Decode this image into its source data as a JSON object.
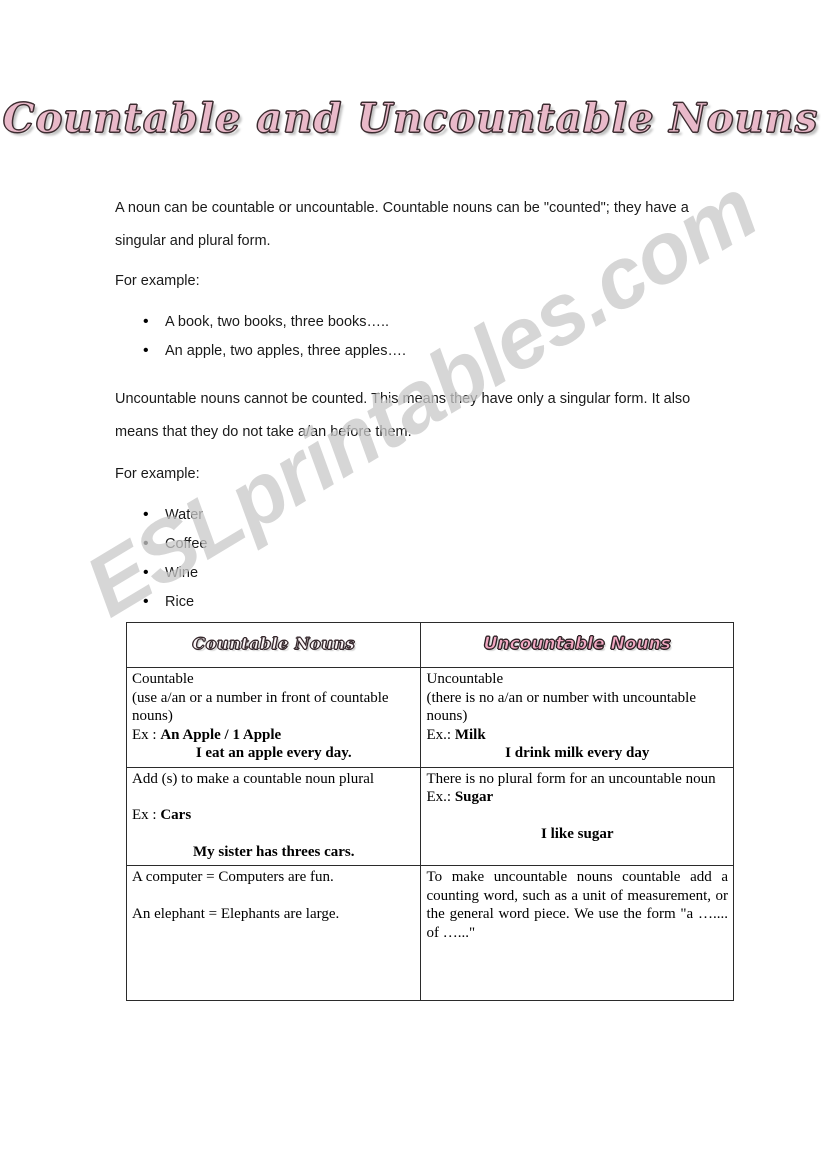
{
  "document": {
    "title": "Countable and Uncountable Nouns",
    "watermark": "ESLprintables.com"
  },
  "intro": {
    "paragraph1": "A noun can be countable or uncountable. Countable nouns can be \"counted\"; they have a singular and plural form.",
    "for_example_1": "For example:",
    "examples1": [
      "A book, two books, three books…..",
      "An apple, two apples, three apples…."
    ],
    "paragraph2": "Uncountable nouns cannot be counted. This means they have only a singular form. It also means that they do not take a/an before them.",
    "for_example_2": "For example:",
    "examples2": [
      "Water",
      "Coffee",
      "Wine",
      "Rice"
    ]
  },
  "table": {
    "headers": {
      "countable": "Countable Nouns",
      "uncountable": "Uncountable Nouns"
    },
    "rows": [
      {
        "countable": {
          "line1": "Countable",
          "line2": "(use a/an or a number in front of countable nouns)",
          "ex_label": "Ex :",
          "ex_value": "An Apple / 1 Apple",
          "sentence": "I eat an apple every day."
        },
        "uncountable": {
          "line1": "Uncountable",
          "line2": "(there is no a/an or number with uncountable nouns)",
          "ex_label": "Ex.:",
          "ex_value": "Milk",
          "sentence": "I drink milk every day"
        }
      },
      {
        "countable": {
          "line1": "Add (s) to make a countable noun plural",
          "ex_label": "Ex :",
          "ex_value": "Cars",
          "sentence": "My sister has threes cars."
        },
        "uncountable": {
          "line1": "There is no plural form for an uncountable noun",
          "ex_label": "Ex.:",
          "ex_value": "Sugar",
          "sentence": "I like sugar"
        }
      },
      {
        "countable": {
          "line1": "A computer = Computers are fun.",
          "line2": "An elephant = Elephants are large."
        },
        "uncountable": {
          "line1": "To make uncountable nouns countable add a counting word, such as a unit of measurement, or the general word piece. We use the form \"a ….... of …...\""
        }
      }
    ]
  },
  "colors": {
    "title_pink": "#e9b9c9",
    "header_pink": "#f2a8c2",
    "watermark_gray": "#c9c9c9",
    "border": "#2b2b2b"
  }
}
